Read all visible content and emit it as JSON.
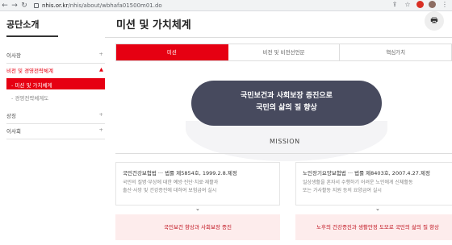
{
  "browser": {
    "back": "←",
    "forward": "→",
    "reload": "↻",
    "url_host": "nhis.or.kr",
    "url_path": "/nhis/about/wbhafa01500m01.do",
    "share_icon": "⇪",
    "star_icon": "☆",
    "menu_icon": "⋮"
  },
  "sidebar": {
    "title": "공단소개",
    "items": [
      {
        "label": "이사장",
        "mark": "+"
      },
      {
        "label": "비전 및 경영전략체계",
        "mark": "▲"
      },
      {
        "label": "상징",
        "mark": "+"
      },
      {
        "label": "이사회",
        "mark": "+"
      }
    ],
    "sub_active": "- 미션 및 가치체계",
    "sub_item": "- 경영전략체계도"
  },
  "main": {
    "title": "미션 및 가치체계",
    "print_icon": "🖶",
    "tabs": [
      {
        "label": "미션",
        "active": true
      },
      {
        "label": "비전 및 비전선언문",
        "active": false
      },
      {
        "label": "핵심가치",
        "active": false
      }
    ],
    "vision_line1": "국민보건과 사회보장 증진으로",
    "vision_line2": "국민의 삶의 질 향상",
    "mission_label": "MISSION",
    "left_card": {
      "title": "국민건강보험법 ··· 법률 제5854호, 1999.2.8.제정",
      "desc1": "국민의 질병·부상에 대한 예방·진단·치료·재활과",
      "desc2": "출산·사망 및 건강증진에 대하여 보험급여 실시"
    },
    "right_card": {
      "title": "노인장기요양보험법 ··· 법률 제8403호, 2007.4.27.제정",
      "desc1": "일상생활을 혼자서 수행하기 어려운 노인에게 신체활동",
      "desc2": "또는 가사활동 지원 등의 요양급여 실시"
    },
    "arrow_glyph": "⌄",
    "left_mission": "국민보건 향상과 사회보장 증진",
    "right_mission": "노후의 건강증진과 생활안정 도모로 국민의 삶의 질 향상"
  }
}
